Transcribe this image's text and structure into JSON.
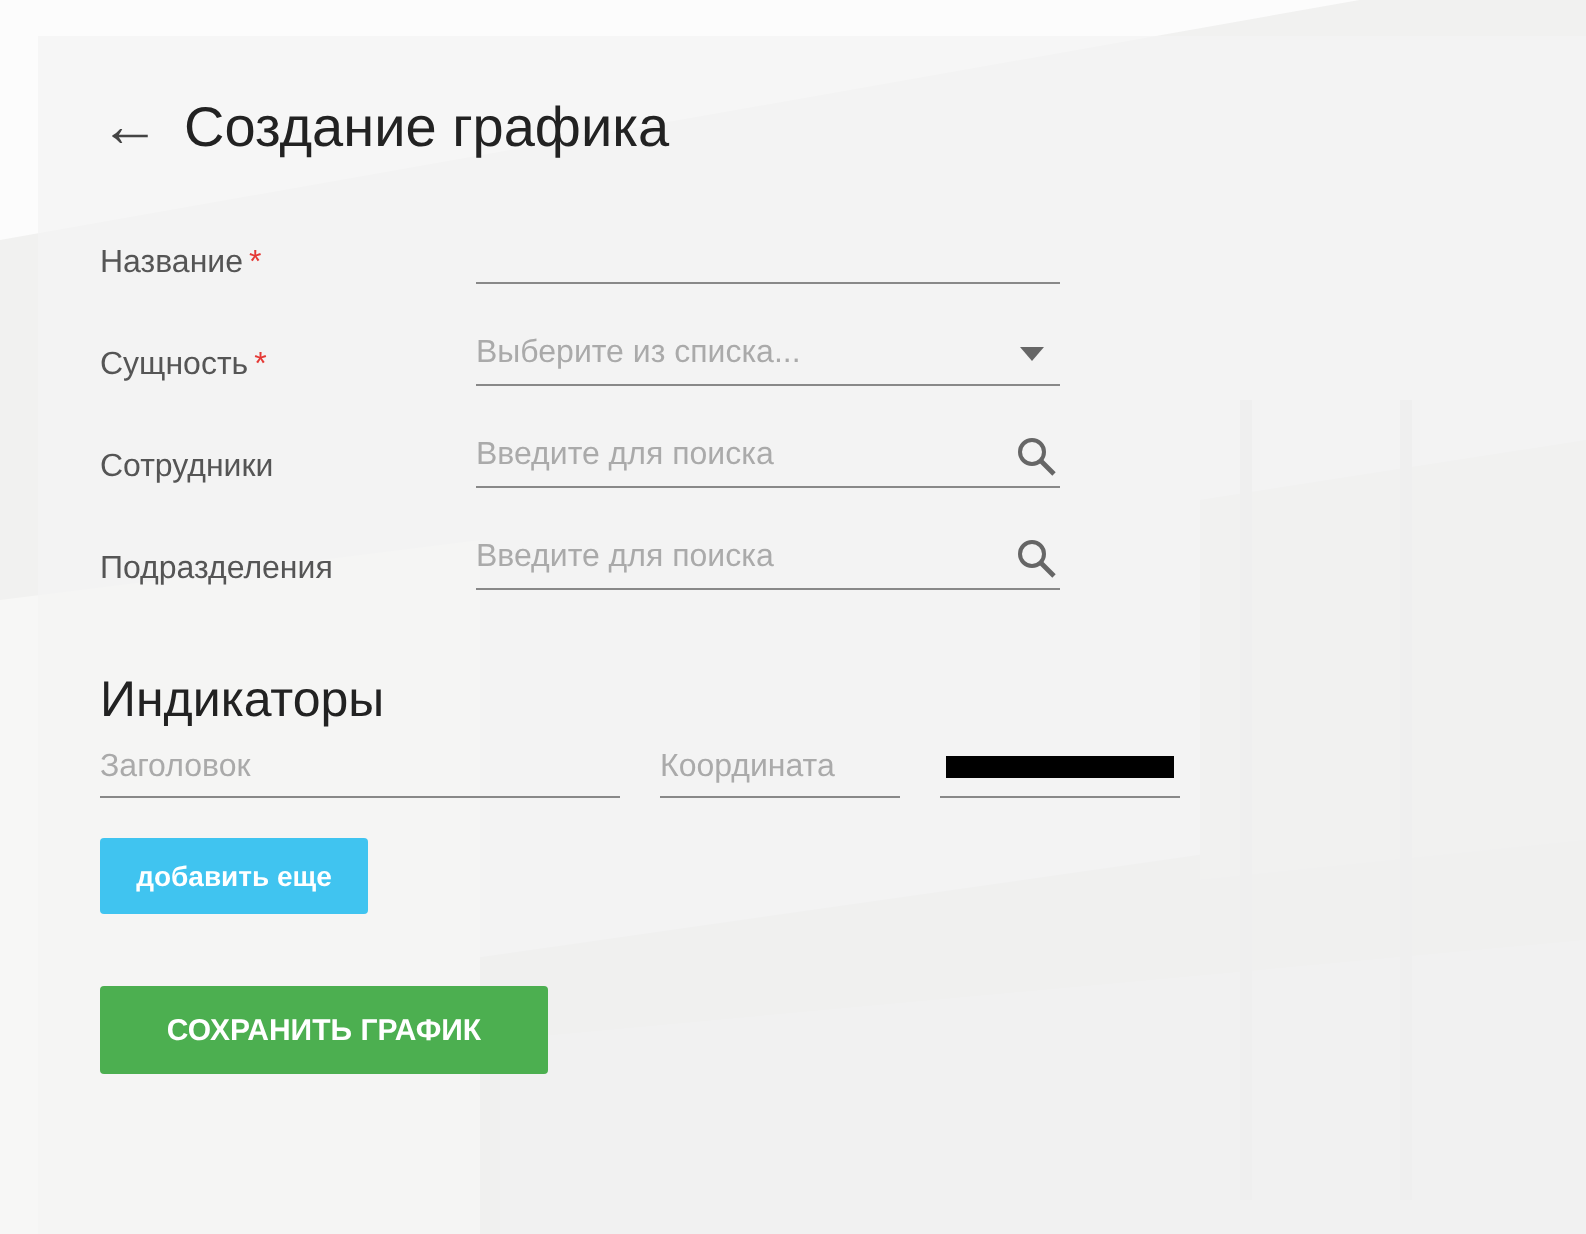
{
  "page": {
    "back_icon": "←",
    "title": "Создание графика"
  },
  "fields": [
    {
      "label": "Название",
      "required_mark": "*",
      "kind": "text"
    },
    {
      "label": "Сущность",
      "required_mark": "*",
      "kind": "select",
      "placeholder": "Выберите из списка..."
    },
    {
      "label": "Сотрудники",
      "kind": "search",
      "placeholder": "Введите для поиска"
    },
    {
      "label": "Подразделения",
      "kind": "search",
      "placeholder": "Введите для поиска"
    }
  ],
  "indicators": {
    "heading": "Индикаторы",
    "rows": [
      {
        "title_placeholder": "Заголовок",
        "coordinate_placeholder": "Координата",
        "color": "#000000"
      }
    ],
    "add_button": "добавить еще"
  },
  "save_button": "СОХРАНИТЬ ГРАФИК"
}
